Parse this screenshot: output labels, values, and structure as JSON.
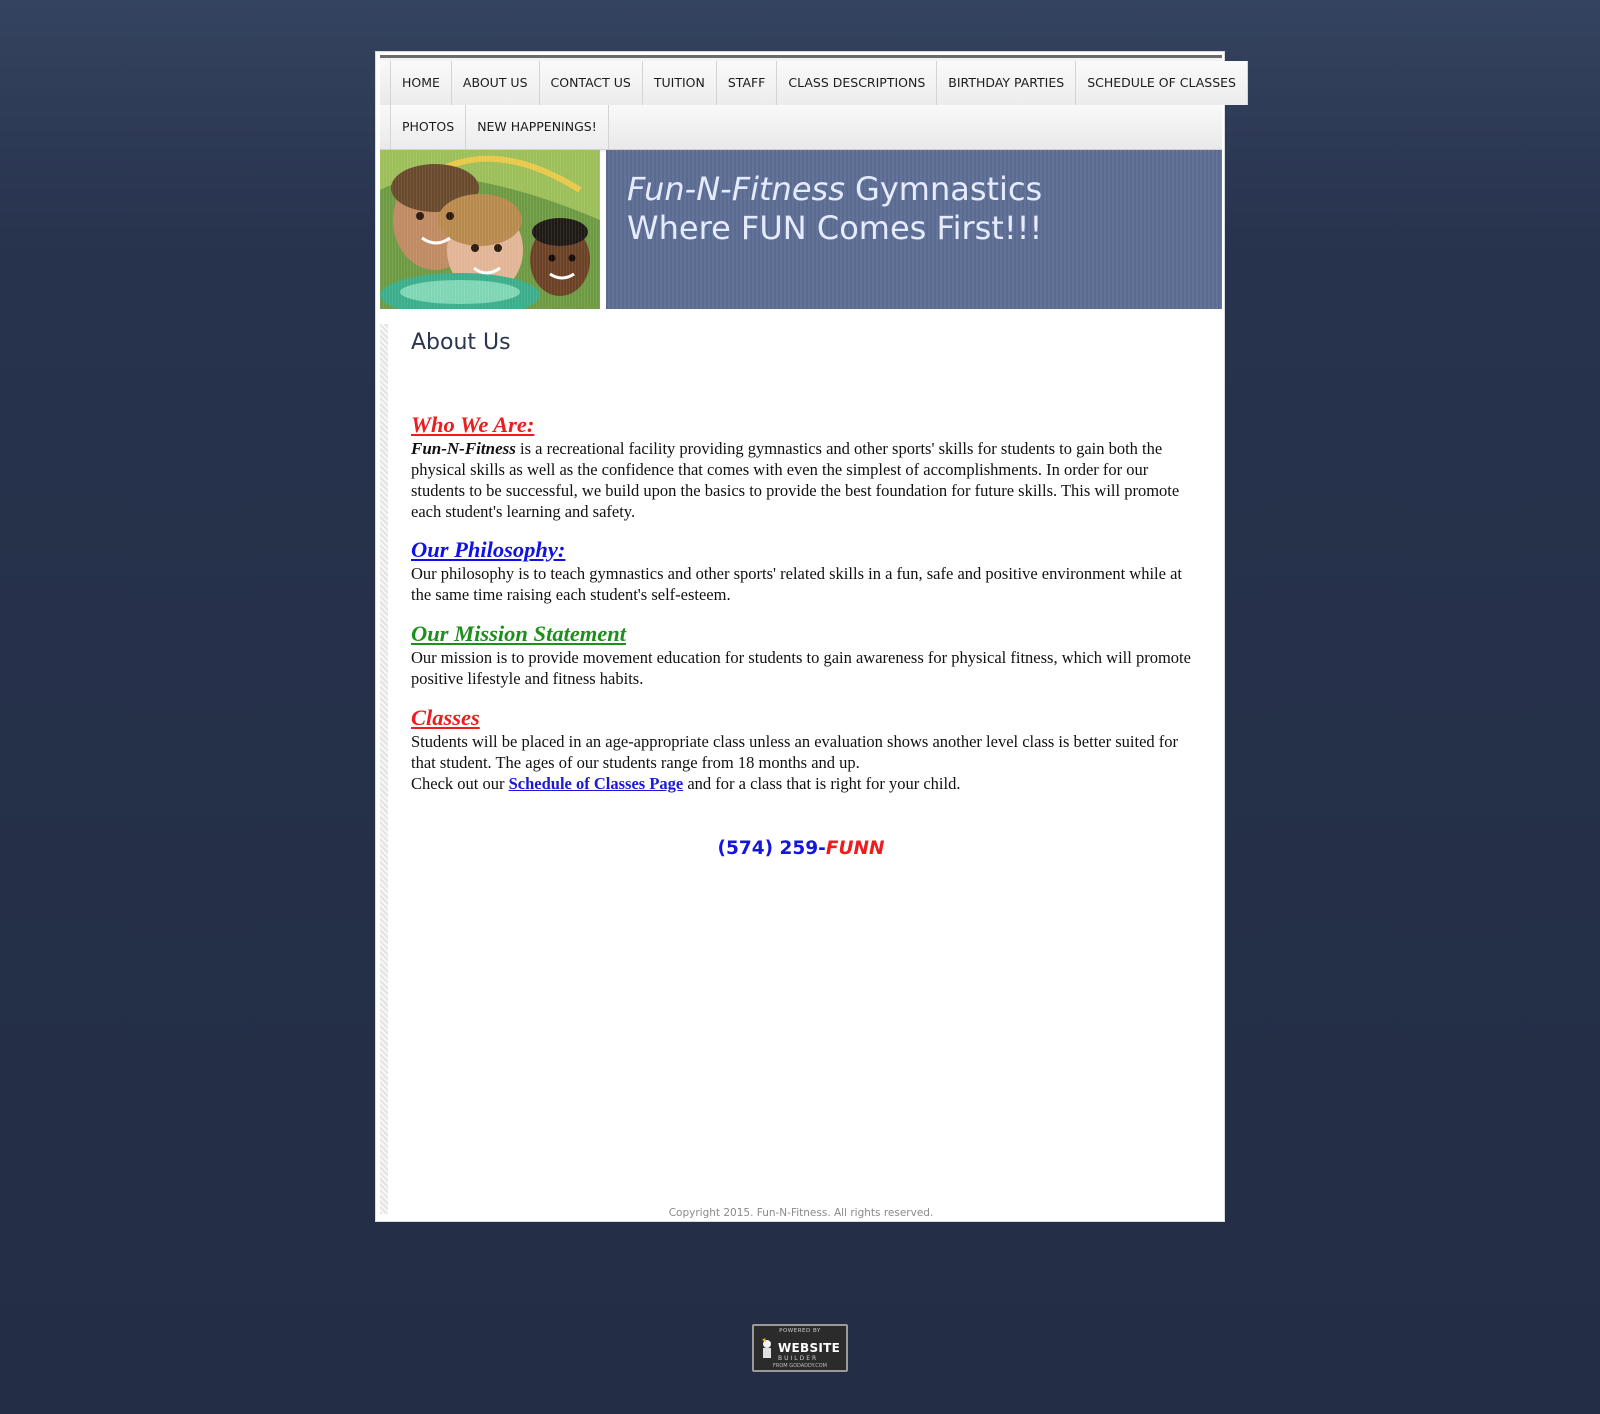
{
  "nav": {
    "row1": [
      "HOME",
      "ABOUT US",
      "CONTACT US",
      "TUITION",
      "STAFF",
      "CLASS DESCRIPTIONS",
      "BIRTHDAY PARTIES",
      "SCHEDULE OF CLASSES"
    ],
    "row2": [
      "PHOTOS",
      "NEW HAPPENINGS!"
    ]
  },
  "banner": {
    "title_italic": "Fun-N-Fitness",
    "title_rest": " Gymnastics",
    "tagline": "Where FUN Comes First!!!"
  },
  "page_title": "About Us",
  "sections": {
    "who": {
      "title": "Who We Are:",
      "brand": "Fun-N-Fitness",
      "text": " is a recreational facility providing gymnastics and other sports' skills for students to gain both the physical skills as well as the confidence that comes with even the simplest of accomplishments.  In order for our students to be successful, we build upon the basics to provide the best foundation for future skills.  This will promote each student's learning and safety."
    },
    "philosophy": {
      "title": "Our Philosophy:",
      "text": "Our philosophy is to teach gymnastics and other sports' related skills in a fun, safe and positive environment while at the same time raising each student's self-esteem."
    },
    "mission": {
      "title": "Our Mission Statement",
      "text": "Our mission is to provide movement education for students to gain awareness for physical fitness, which will promote positive lifestyle and fitness habits."
    },
    "classes": {
      "title": "Classes",
      "text": "Students will be placed in an age-appropriate class unless an evaluation shows another level class is better suited for that student.  The ages of our students range from 18 months and up.",
      "check_prefix": "Check out our ",
      "link_label": "Schedule of Classes Page",
      "check_suffix": " and for a class that is right for your child."
    }
  },
  "phone": {
    "number": "(574) 259-",
    "word": "FUNN"
  },
  "copyright": "Copyright 2015. Fun-N-Fitness. All rights reserved.",
  "badge": {
    "top": "POWERED BY",
    "main": "WEBSITE",
    "sub": "BUILDER",
    "foot": "FROM GODADDY.COM"
  }
}
